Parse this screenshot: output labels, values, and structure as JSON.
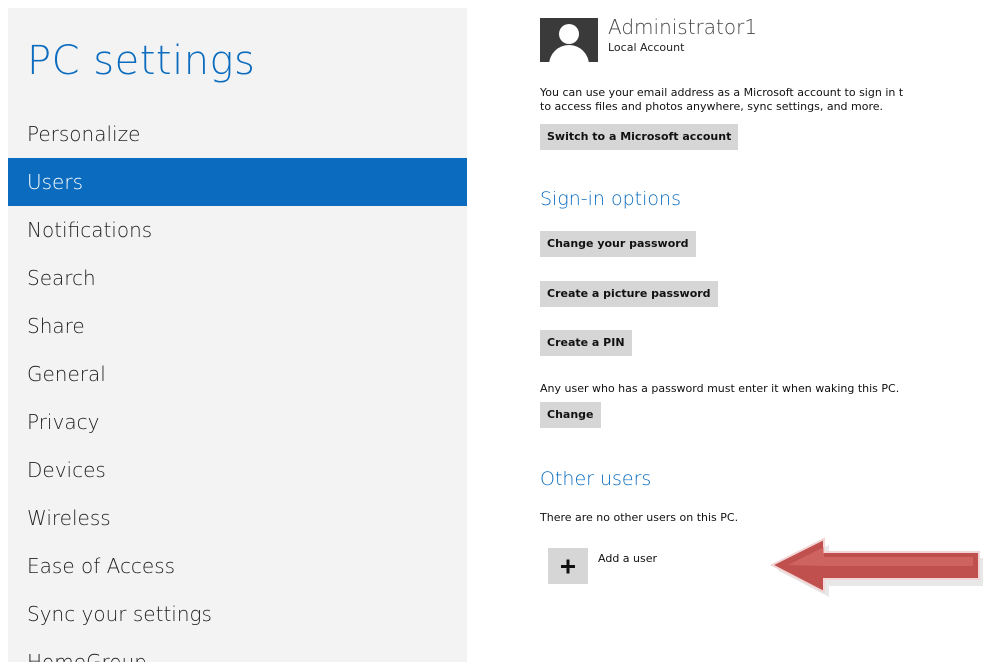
{
  "left_pane": {
    "title": "PC settings",
    "nav_items": [
      {
        "label": "Personalize",
        "selected": false
      },
      {
        "label": "Users",
        "selected": true
      },
      {
        "label": "Notifications",
        "selected": false
      },
      {
        "label": "Search",
        "selected": false
      },
      {
        "label": "Share",
        "selected": false
      },
      {
        "label": "General",
        "selected": false
      },
      {
        "label": "Privacy",
        "selected": false
      },
      {
        "label": "Devices",
        "selected": false
      },
      {
        "label": "Wireless",
        "selected": false
      },
      {
        "label": "Ease of Access",
        "selected": false
      },
      {
        "label": "Sync your settings",
        "selected": false
      },
      {
        "label": "HomeGroup",
        "selected": false
      }
    ]
  },
  "account": {
    "avatar_icon": "user-avatar-icon",
    "name": "Administrator1",
    "type": "Local Account",
    "description_line1": "You can use your email address as a Microsoft account to sign in t",
    "description_line2": "to access files and photos anywhere, sync settings, and more.",
    "switch_button": "Switch to a Microsoft account"
  },
  "signin": {
    "title": "Sign-in options",
    "change_password_button": "Change your password",
    "picture_password_button": "Create a picture password",
    "pin_button": "Create a PIN",
    "wake_text": "Any user who has a password must enter it when waking this PC.",
    "change_button": "Change"
  },
  "other_users": {
    "title": "Other users",
    "empty_text": "There are no other users on this PC.",
    "add_icon": "plus-icon",
    "add_label": "Add a user"
  },
  "colors": {
    "accent": "#0b6cbf",
    "pane_background": "#f3f3f3",
    "button_background": "#d6d6d6",
    "annotation_arrow": "#c0504d"
  }
}
